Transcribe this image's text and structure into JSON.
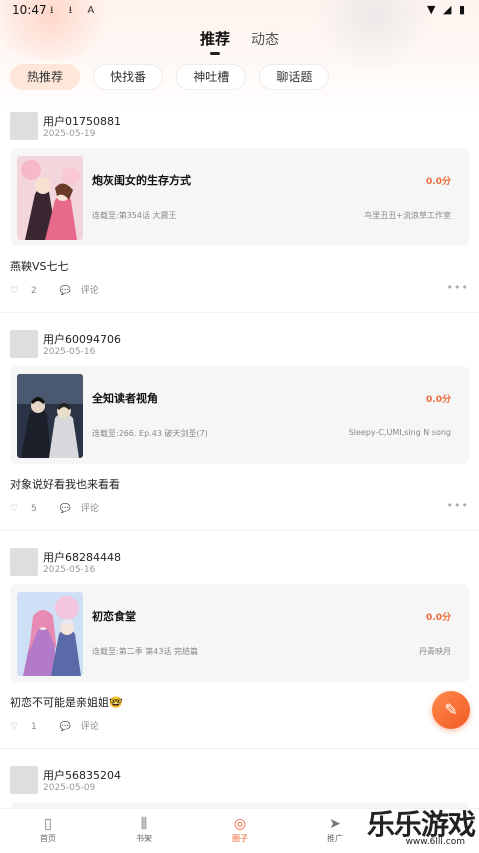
{
  "status": {
    "time": "10:47",
    "icons": "⭳ ⭳ A",
    "right": "▼ ◢ ▮"
  },
  "tabs": [
    {
      "label": "推荐"
    },
    {
      "label": "动态"
    }
  ],
  "chips": [
    {
      "label": "热推荐"
    },
    {
      "label": "快找番"
    },
    {
      "label": "神吐槽"
    },
    {
      "label": "聊话题"
    }
  ],
  "posts": [
    {
      "user": "用户01750881",
      "date": "2025-05-19",
      "book": {
        "title": "炮灰闺女的生存方式",
        "score": "0.0分",
        "progress": "连载至:第354话 大震王",
        "author": "鸟里丑丑+流浪草工作室"
      },
      "text": "燕鞅VS七七",
      "likes": "2",
      "comment_label": "评论"
    },
    {
      "user": "用户60094706",
      "date": "2025-05-16",
      "book": {
        "title": "全知读者视角",
        "score": "0.0分",
        "progress": "连载至:266. Ep.43 破天剑圣(7)",
        "author": "Sleepy-C,UMI,sing N song"
      },
      "text": "对象说好看我也来看看",
      "likes": "5",
      "comment_label": "评论"
    },
    {
      "user": "用户68284448",
      "date": "2025-05-16",
      "book": {
        "title": "初恋食堂",
        "score": "0.0分",
        "progress": "连载至:第二季 第43话 完结篇",
        "author": "丹青映月"
      },
      "text": "初恋不可能是亲姐姐🤓",
      "likes": "1",
      "comment_label": "评论"
    },
    {
      "user": "用户56835204",
      "date": "2025-05-09"
    }
  ],
  "nav": [
    {
      "label": "首页"
    },
    {
      "label": "书架"
    },
    {
      "label": "圈子"
    },
    {
      "label": "推广"
    }
  ],
  "watermark": {
    "title": "乐乐游戏",
    "url": "www.6lll.com"
  },
  "colors": {
    "accent": "#f0642f",
    "score": "#ee6a3a",
    "chip_active": "#fde7da"
  }
}
